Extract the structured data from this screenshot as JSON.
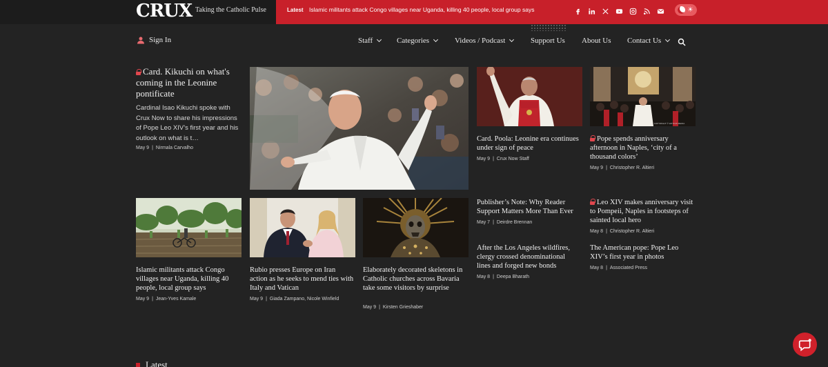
{
  "brand": {
    "logo": "CRUX",
    "tagline": "Taking the Catholic Pulse"
  },
  "ticker": {
    "label": "Latest",
    "headline": "Islamic militants attack Congo villages near Uganda, killing 40 people, local group says"
  },
  "social_icons": [
    "facebook-icon",
    "linkedin-icon",
    "x-icon",
    "youtube-icon",
    "instagram-icon",
    "rss-icon",
    "email-icon"
  ],
  "nav": {
    "signin": "Sign In",
    "items": [
      "Staff",
      "Categories",
      "Videos / Podcast",
      "Support Us",
      "About Us",
      "Contact Us"
    ]
  },
  "featured": {
    "headline": "Card. Kikuchi on what's coming in the Leonine pontificate",
    "dek": "Cardinal Isao Kikuchi spoke with Crux Now to share his impressions of Pope Leo XIV’s first year and his outlook on what is t…",
    "date": "May 9",
    "author": "Nirmala Carvalho"
  },
  "stories": [
    {
      "headline": "Card. Poola: Leonine era continues under sign of peace",
      "date": "May 9",
      "author": "Crux Now Staff",
      "locked": false
    },
    {
      "headline": "Pope spends anniversary afternoon in Naples, ‘city of a thousand colors’",
      "date": "May 9",
      "author": "Christopher R. Altieri",
      "locked": true
    },
    {
      "headline": "Islamic militants attack Congo villages near Uganda, killing 40 people, local group says",
      "date": "May 9",
      "author": "Jean-Yves Kamale",
      "locked": false
    },
    {
      "headline": "Rubio presses Europe on Iran action as he seeks to mend ties with Italy and Vatican",
      "date": "May 9",
      "author": "Giada Zampano, Nicole Winfield",
      "locked": false
    },
    {
      "headline": "Elaborately decorated skeletons in Catholic churches across Bavaria take some visitors by surprise",
      "date": "May 9",
      "author": "Kirsten Grieshaber",
      "locked": false
    },
    {
      "headline": "Publisher’s Note: Why Reader Support Matters More Than Ever",
      "date": "May 7",
      "author": "Deirdre Brennan",
      "locked": false
    },
    {
      "headline": "Leo XIV makes anniversary visit to Pompeii, Naples in footsteps of sainted local hero",
      "date": "May 8",
      "author": "Christopher R. Altieri",
      "locked": true
    },
    {
      "headline": "After the Los Angeles wildfires, clergy crossed denominational lines and forged new bonds",
      "date": "May 8",
      "author": "Deepa Bharath",
      "locked": false
    },
    {
      "headline": "The American pope: Pope Leo XIV’s first year in photos",
      "date": "May 8",
      "author": "Associated Press",
      "locked": false
    }
  ],
  "image_watermark": "COPYRIGHT © VATICAN MEDIA",
  "latest_section": "Latest",
  "colors": {
    "accent": "#c8202a",
    "background": "#232323",
    "topbar": "#1c1c1c"
  }
}
